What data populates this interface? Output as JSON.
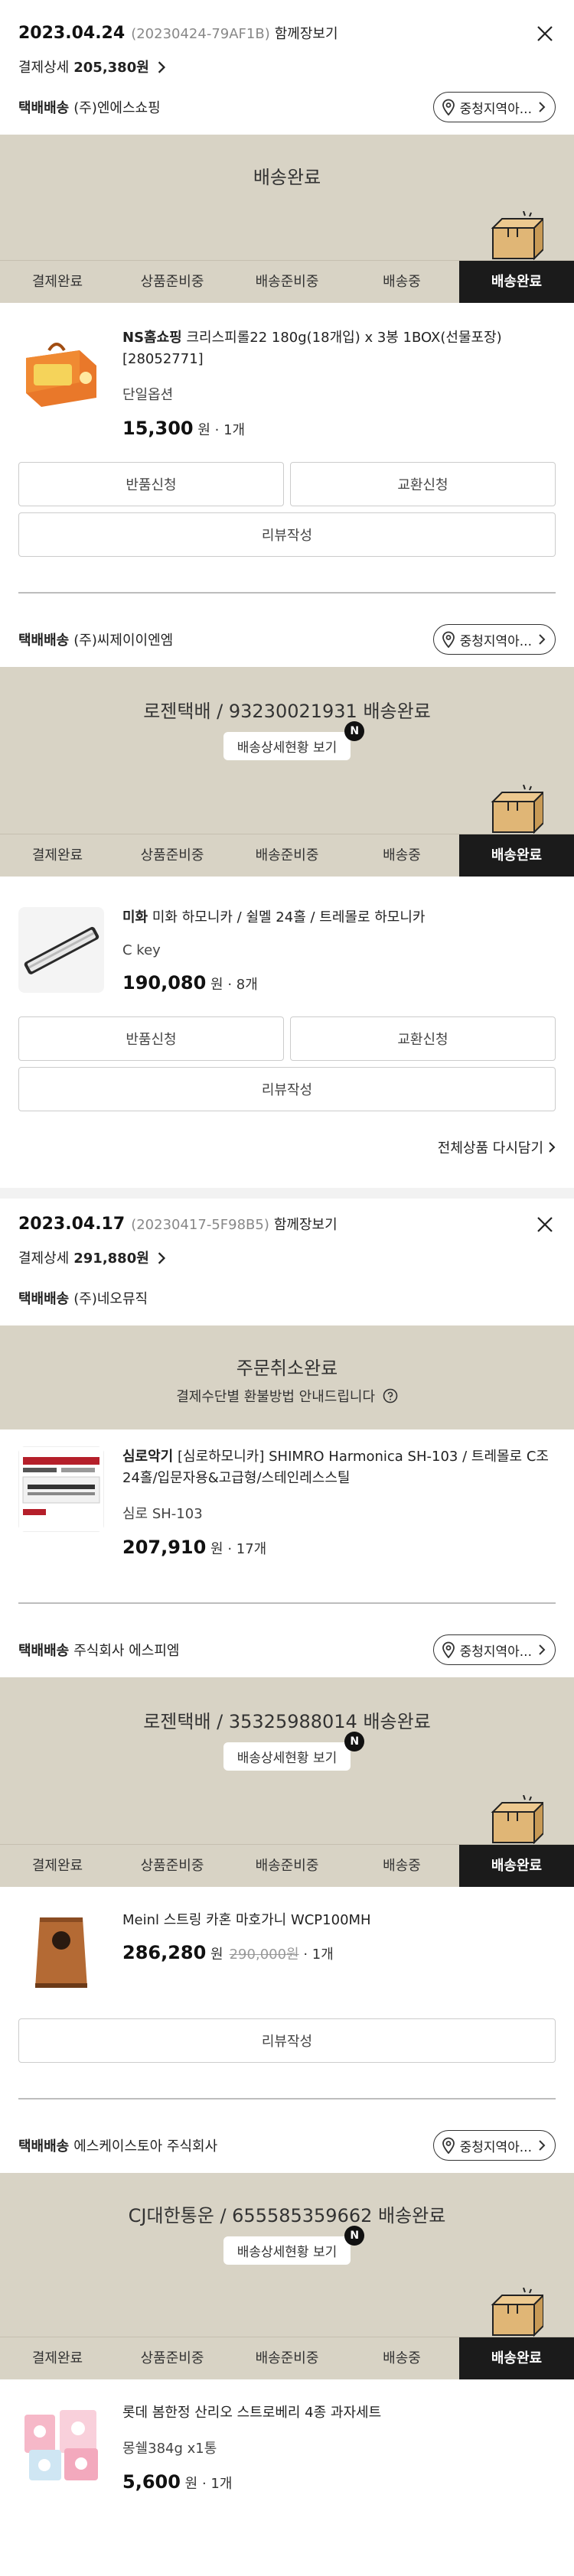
{
  "orders": [
    {
      "date": "2023.04.24",
      "order_no": "(20230424-79AF1B)",
      "shipping_together": "함께장보기",
      "pay_label": "결제상세",
      "pay_amount": "205,380원",
      "shipments": [
        {
          "carrier_label": "택배배송",
          "seller": "(주)엔에스쇼핑",
          "region_btn": "중청지역아...",
          "status_title": "배송완료",
          "steps": [
            "결제완료",
            "상품준비중",
            "배송준비중",
            "배송중",
            "배송완료"
          ],
          "product": {
            "brand": "NS홈쇼핑",
            "name": "크리스피롤22 180g(18개입) x 3봉 1BOX(선물포장) [28052771]",
            "option": "단일옵션",
            "price": "15,300",
            "unit": "원",
            "qty": "1개"
          },
          "buttons": {
            "return": "반품신청",
            "exchange": "교환신청",
            "review": "리뷰작성"
          }
        },
        {
          "carrier_label": "택배배송",
          "seller": "(주)씨제이이엔엠",
          "region_btn": "중청지역아...",
          "status_title": "로젠택배 / 93230021931 배송완료",
          "detail_btn": "배송상세현황 보기",
          "badge": "N",
          "steps": [
            "결제완료",
            "상품준비중",
            "배송준비중",
            "배송중",
            "배송완료"
          ],
          "product": {
            "brand": "미화",
            "name": "미화 하모니카 / 쉴멜 24홀 / 트레몰로 하모니카",
            "option": "C key",
            "price": "190,080",
            "unit": "원",
            "qty": "8개"
          },
          "buttons": {
            "return": "반품신청",
            "exchange": "교환신청",
            "review": "리뷰작성"
          }
        }
      ],
      "reorder": "전체상품 다시담기"
    },
    {
      "date": "2023.04.17",
      "order_no": "(20230417-5F98B5)",
      "shipping_together": "함께장보기",
      "pay_label": "결제상세",
      "pay_amount": "291,880원",
      "shipments": [
        {
          "carrier_label": "택배배송",
          "seller": "(주)네오뮤직",
          "status_title": "주문취소완료",
          "status_sub": "결제수단별 환불방법 안내드립니다",
          "product": {
            "brand": "심로악기",
            "name": "[심로하모니카] SHIMRO Harmonica SH-103 / 트레몰로 C조 24홀/입문자용&고급형/스테인레스스틸",
            "option": "심로 SH-103",
            "price": "207,910",
            "unit": "원",
            "qty": "17개"
          }
        },
        {
          "carrier_label": "택배배송",
          "seller": "주식회사 에스피엠",
          "region_btn": "중청지역아...",
          "status_title": "로젠택배 / 35325988014 배송완료",
          "detail_btn": "배송상세현황 보기",
          "badge": "N",
          "steps": [
            "결제완료",
            "상품준비중",
            "배송준비중",
            "배송중",
            "배송완료"
          ],
          "product": {
            "brand": "",
            "name": "Meinl 스트링 카혼 마호가니 WCP100MH",
            "price": "286,280",
            "unit": "원",
            "orig_price": "290,000원",
            "qty": "1개"
          },
          "buttons": {
            "review": "리뷰작성"
          }
        },
        {
          "carrier_label": "택배배송",
          "seller": "에스케이스토아 주식회사",
          "region_btn": "중청지역아...",
          "status_title": "CJ대한통운 / 655585359662 배송완료",
          "detail_btn": "배송상세현황 보기",
          "badge": "N",
          "steps": [
            "결제완료",
            "상품준비중",
            "배송준비중",
            "배송중",
            "배송완료"
          ],
          "product": {
            "brand": "",
            "name": "롯데 봄한정 산리오 스트로베리 4종 과자세트",
            "option": "몽쉘384g x1통",
            "price": "5,600",
            "unit": "원",
            "qty": "1개"
          }
        }
      ]
    }
  ],
  "icons": {
    "close": "close-icon",
    "pin": "location-pin-icon",
    "chevron": "chevron-right-icon",
    "box": "delivery-box-icon",
    "help": "help-circle-icon"
  },
  "colors": {
    "band": "#d8d3c5",
    "active_step": "#1b1b1b"
  }
}
